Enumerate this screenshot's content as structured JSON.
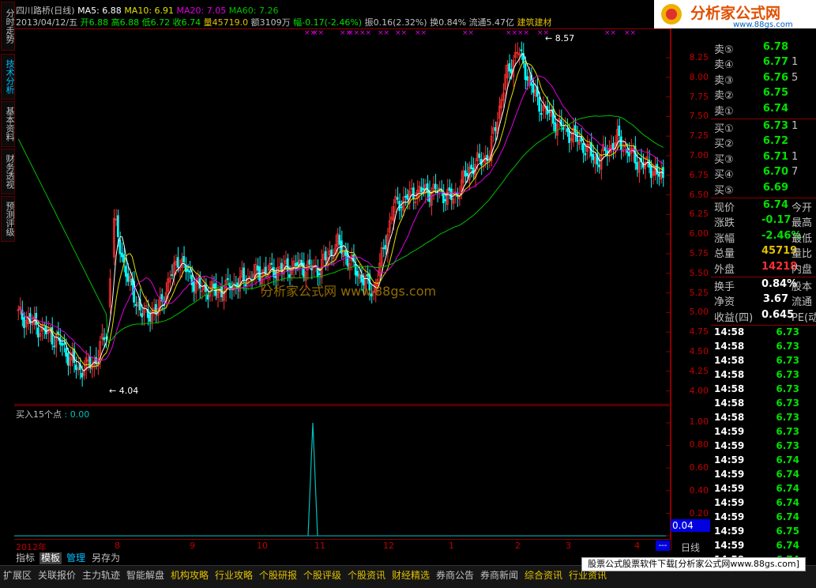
{
  "side_tabs": [
    "分时走势",
    "技术分析",
    "基本资料",
    "财务透视",
    "预测评级"
  ],
  "header": {
    "stock": "四川路桥(日线)",
    "ma5": "MA5: 6.88",
    "ma10": "MA10: 6.91",
    "ma20": "MA20: 7.05",
    "ma60": "MA60: 7.26",
    "date": "2013/04/12/五",
    "open": "开6.88",
    "high": "高6.88",
    "low": "低6.72",
    "close": "收6.74",
    "vol": "量45719.0",
    "amount": "额3109万",
    "change": "幅-0.17(-2.46%)",
    "amplitude": "振0.16(2.32%)",
    "turnover": "换0.84%",
    "float_cap": "流通5.47亿",
    "sector": "建筑建材"
  },
  "annotations": {
    "high_label": "8.57",
    "low_label": "4.04",
    "watermark": "分析家公式网 www.88gs.com"
  },
  "main_axis": [
    "8.25",
    "8.00",
    "7.75",
    "7.50",
    "7.25",
    "7.00",
    "6.75",
    "6.50",
    "6.25",
    "6.00",
    "5.75",
    "5.50",
    "5.25",
    "5.00",
    "4.75",
    "4.50",
    "4.25",
    "4.00"
  ],
  "sub_header": {
    "name": "买入15个点",
    "value": ": 0.00"
  },
  "sub_axis": [
    "1.00",
    "0.80",
    "0.60",
    "0.40",
    "0.20"
  ],
  "sub_current": "0.04",
  "x_axis": [
    "2012年",
    "8",
    "9",
    "10",
    "11",
    "12",
    "1",
    "2",
    "3",
    "4"
  ],
  "period_label": "日线",
  "quote": {
    "order_book": [
      {
        "label": "卖⑤",
        "price": "6.78",
        "extra": "",
        "color": "#00e000"
      },
      {
        "label": "卖④",
        "price": "6.77",
        "extra": "1",
        "color": "#00e000"
      },
      {
        "label": "卖③",
        "price": "6.76",
        "extra": "5",
        "color": "#00e000"
      },
      {
        "label": "卖②",
        "price": "6.75",
        "extra": "",
        "color": "#00e000"
      },
      {
        "label": "卖①",
        "price": "6.74",
        "extra": "",
        "color": "#00e000"
      },
      {
        "label": "买①",
        "price": "6.73",
        "extra": "1",
        "color": "#00e000"
      },
      {
        "label": "买②",
        "price": "6.72",
        "extra": "",
        "color": "#00e000"
      },
      {
        "label": "买③",
        "price": "6.71",
        "extra": "1",
        "color": "#00e000"
      },
      {
        "label": "买④",
        "price": "6.70",
        "extra": "7",
        "color": "#00e000"
      },
      {
        "label": "买⑤",
        "price": "6.69",
        "extra": "",
        "color": "#00e000"
      }
    ],
    "stats": [
      {
        "label": "现价",
        "value": "6.74",
        "extra": "今开",
        "color": "#00e000"
      },
      {
        "label": "涨跌",
        "value": "-0.17",
        "extra": "最高",
        "color": "#00e000"
      },
      {
        "label": "涨幅",
        "value": "-2.46%",
        "extra": "最低",
        "color": "#00e000"
      },
      {
        "label": "总量",
        "value": "45719",
        "extra": "量比",
        "color": "#e0c000"
      },
      {
        "label": "外盘",
        "value": "14218",
        "extra": "内盘",
        "color": "#ff3030"
      }
    ],
    "stats2": [
      {
        "label": "换手",
        "value": "0.84%",
        "extra": "股本",
        "color": "#ffffff"
      },
      {
        "label": "净资",
        "value": "3.67",
        "extra": "流通",
        "color": "#ffffff"
      },
      {
        "label": "收益(四)",
        "value": "0.645",
        "extra": "PE(动",
        "color": "#ffffff"
      }
    ],
    "ticks": [
      {
        "time": "14:58",
        "price": "6.73"
      },
      {
        "time": "14:58",
        "price": "6.73"
      },
      {
        "time": "14:58",
        "price": "6.73"
      },
      {
        "time": "14:58",
        "price": "6.73"
      },
      {
        "time": "14:58",
        "price": "6.73"
      },
      {
        "time": "14:58",
        "price": "6.73"
      },
      {
        "time": "14:58",
        "price": "6.73"
      },
      {
        "time": "14:59",
        "price": "6.73"
      },
      {
        "time": "14:59",
        "price": "6.73"
      },
      {
        "time": "14:59",
        "price": "6.74"
      },
      {
        "time": "14:59",
        "price": "6.74"
      },
      {
        "time": "14:59",
        "price": "6.74"
      },
      {
        "time": "14:59",
        "price": "6.74"
      },
      {
        "time": "14:59",
        "price": "6.74"
      },
      {
        "time": "14:59",
        "price": "6.75"
      },
      {
        "time": "14:59",
        "price": "6.74"
      },
      {
        "time": "14:59",
        "price": "6.74"
      }
    ]
  },
  "toolbar": [
    "指标",
    "模板",
    "管理",
    "另存为"
  ],
  "menu": [
    {
      "label": "扩展区",
      "color": "#c0c0c0"
    },
    {
      "label": "关联报价",
      "color": "#c0c0c0"
    },
    {
      "label": "主力轨迹",
      "color": "#c0c0c0"
    },
    {
      "label": "智能解盘",
      "color": "#c0c0c0"
    },
    {
      "label": "机构攻略",
      "color": "#e0c000"
    },
    {
      "label": "行业攻略",
      "color": "#e0c000"
    },
    {
      "label": "个股研报",
      "color": "#e0c000"
    },
    {
      "label": "个股评级",
      "color": "#e0c000"
    },
    {
      "label": "个股资讯",
      "color": "#e0c000"
    },
    {
      "label": "财经精选",
      "color": "#e0c000"
    },
    {
      "label": "券商公告",
      "color": "#c0c0c0"
    },
    {
      "label": "券商新闻",
      "color": "#c0c0c0"
    },
    {
      "label": "综合资讯",
      "color": "#e0c000"
    },
    {
      "label": "行业资讯",
      "color": "#e0c000"
    }
  ],
  "banner": "股票公式股票软件下载[分析家公式网www.88gs.com]",
  "logo": {
    "text": "分析家公式网",
    "url": "www.88gs.com"
  },
  "colors": {
    "up": "#ff3030",
    "down": "#00ffff",
    "ma5": "#ffffff",
    "ma10": "#e0e000",
    "ma20": "#e000e0",
    "ma60": "#00c000",
    "grid": "#8b0000"
  }
}
